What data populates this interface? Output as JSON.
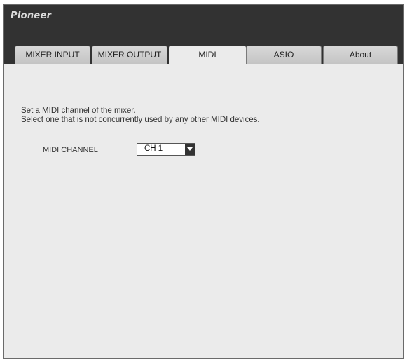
{
  "app": {
    "brand": "Pioneer"
  },
  "tabs": [
    {
      "label": "MIXER INPUT",
      "active": false
    },
    {
      "label": "MIXER OUTPUT",
      "active": false
    },
    {
      "label": "MIDI",
      "active": true
    },
    {
      "label": "ASIO",
      "active": false
    },
    {
      "label": "About",
      "active": false
    }
  ],
  "midi": {
    "description_line1": "Set a MIDI channel of the mixer.",
    "description_line2": "Select one that is not concurrently used by any other MIDI devices.",
    "channel_label": "MIDI CHANNEL",
    "channel_value": "CH 1"
  },
  "colors": {
    "header_bg": "#323232",
    "content_bg": "#ebebeb"
  }
}
